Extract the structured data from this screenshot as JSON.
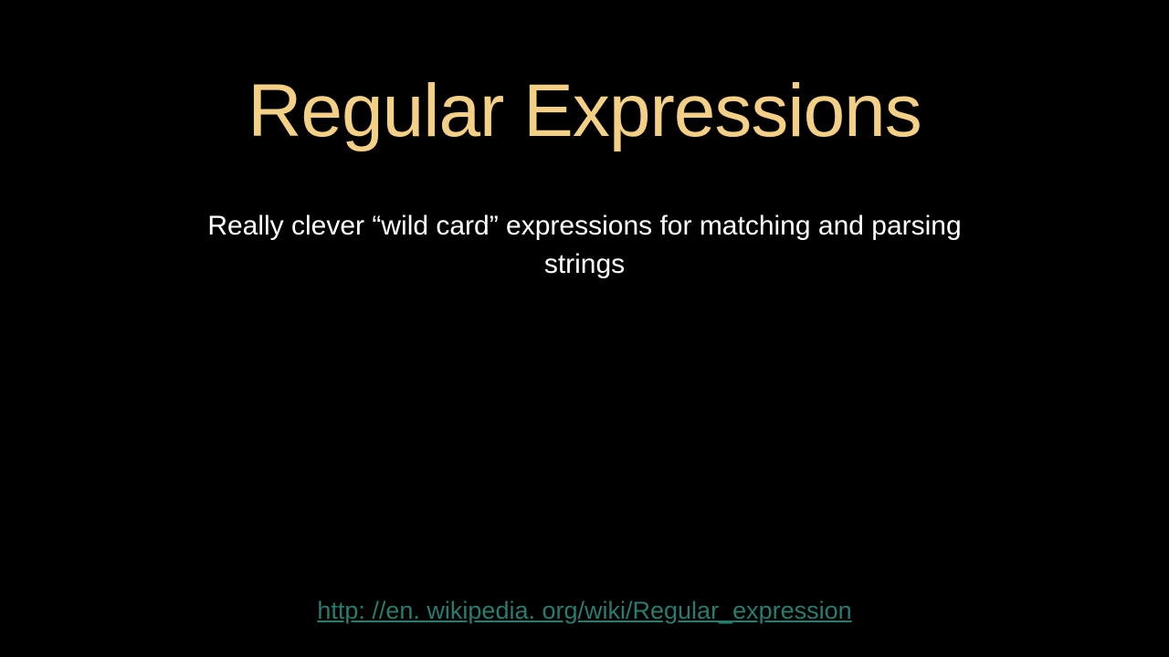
{
  "slide": {
    "title": "Regular Expressions",
    "subtitle": "Really clever “wild card” expressions for matching and parsing strings",
    "link_text": "http: //en. wikipedia. org/wiki/Regular_expression"
  }
}
